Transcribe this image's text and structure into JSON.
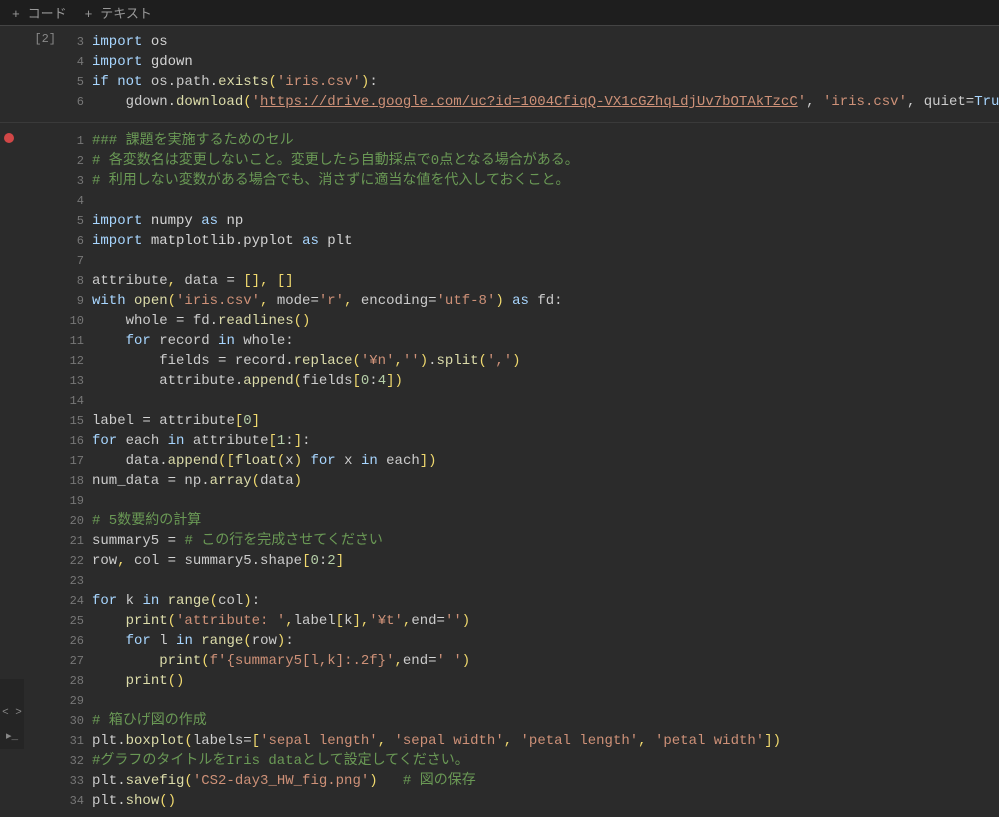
{
  "toolbar": {
    "code_btn": "+ コード",
    "text_btn": "+ テキスト"
  },
  "cell1": {
    "prompt": "[2]",
    "lines": [
      {
        "n": "3",
        "html": "<span class='kw'>import</span> <span class='mod'>os</span>"
      },
      {
        "n": "4",
        "html": "<span class='kw'>import</span> <span class='mod'>gdown</span>"
      },
      {
        "n": "5",
        "html": "<span class='kw'>if</span> <span class='kw'>not</span> os.path.<span class='builtin'>exists</span><span class='pun'>(</span><span class='str'>'iris.csv'</span><span class='pun'>)</span>:"
      },
      {
        "n": "6",
        "html": "    gdown.<span class='builtin'>download</span><span class='pun'>(</span><span class='str'>'<span class='url'>https://drive.google.com/uc?id=1004CfiqQ-VX1cGZhqLdjUv7bOTAkTzcC</span>'</span>, <span class='str'>'iris.csv'</span>, quiet=<span class='kw'>True</span><span class='pun'>)</span>"
      }
    ]
  },
  "cell2": {
    "lines": [
      {
        "n": "1",
        "html": "<span class='cmt'>### 課題を実施するためのセル</span>"
      },
      {
        "n": "2",
        "html": "<span class='cmt'># 各変数名は変更しないこと。変更したら自動採点で0点となる場合がある。</span>"
      },
      {
        "n": "3",
        "html": "<span class='cmt'># 利用しない変数がある場合でも、消さずに適当な値を代入しておくこと。</span>"
      },
      {
        "n": "4",
        "html": ""
      },
      {
        "n": "5",
        "html": "<span class='kw'>import</span> <span class='mod'>numpy</span> <span class='kw'>as</span> <span class='mod'>np</span>"
      },
      {
        "n": "6",
        "html": "<span class='kw'>import</span> <span class='mod'>matplotlib.pyplot</span> <span class='kw'>as</span> <span class='mod'>plt</span>"
      },
      {
        "n": "7",
        "html": ""
      },
      {
        "n": "8",
        "html": "attribute<span class='pun'>,</span> data <span class='op'>=</span> <span class='pun'>[]</span><span class='pun'>,</span> <span class='pun'>[]</span>"
      },
      {
        "n": "9",
        "html": "<span class='kw'>with</span> <span class='builtin'>open</span><span class='pun'>(</span><span class='str'>'iris.csv'</span><span class='pun'>,</span> mode<span class='op'>=</span><span class='str'>'r'</span><span class='pun'>,</span> encoding<span class='op'>=</span><span class='str'>'utf-8'</span><span class='pun'>)</span> <span class='kw'>as</span> fd:"
      },
      {
        "n": "10",
        "html": "    whole <span class='op'>=</span> fd.<span class='builtin'>readlines</span><span class='pun'>()</span>"
      },
      {
        "n": "11",
        "html": "    <span class='kw'>for</span> record <span class='kw'>in</span> whole:"
      },
      {
        "n": "12",
        "html": "        fields <span class='op'>=</span> record.<span class='builtin'>replace</span><span class='pun'>(</span><span class='str'>'¥n'</span><span class='pun'>,</span><span class='str'>''</span><span class='pun'>)</span>.<span class='builtin'>split</span><span class='pun'>(</span><span class='str'>','</span><span class='pun'>)</span>"
      },
      {
        "n": "13",
        "html": "        attribute.<span class='builtin'>append</span><span class='pun'>(</span>fields<span class='pun'>[</span><span class='num'>0</span>:<span class='num'>4</span><span class='pun'>])</span>"
      },
      {
        "n": "14",
        "html": ""
      },
      {
        "n": "15",
        "html": "label <span class='op'>=</span> attribute<span class='pun'>[</span><span class='num'>0</span><span class='pun'>]</span>"
      },
      {
        "n": "16",
        "html": "<span class='kw'>for</span> each <span class='kw'>in</span> attribute<span class='pun'>[</span><span class='num'>1</span>:<span class='pun'>]</span>:"
      },
      {
        "n": "17",
        "html": "    data.<span class='builtin'>append</span><span class='pun'>([</span><span class='builtin'>float</span><span class='pun'>(</span>x<span class='pun'>)</span> <span class='kw'>for</span> x <span class='kw'>in</span> each<span class='pun'>])</span>"
      },
      {
        "n": "18",
        "html": "num_data <span class='op'>=</span> np.<span class='builtin'>array</span><span class='pun'>(</span>data<span class='pun'>)</span>"
      },
      {
        "n": "19",
        "html": ""
      },
      {
        "n": "20",
        "html": "<span class='cmt'># 5数要約の計算</span>"
      },
      {
        "n": "21",
        "html": "summary5 <span class='op'>=</span> <span class='cmt'># この行を完成させてください</span>"
      },
      {
        "n": "22",
        "html": "row<span class='pun'>,</span> col <span class='op'>=</span> summary5.shape<span class='pun'>[</span><span class='num'>0</span>:<span class='num'>2</span><span class='pun'>]</span>"
      },
      {
        "n": "23",
        "html": ""
      },
      {
        "n": "24",
        "html": "<span class='kw'>for</span> k <span class='kw'>in</span> <span class='builtin'>range</span><span class='pun'>(</span>col<span class='pun'>)</span>:"
      },
      {
        "n": "25",
        "html": "    <span class='builtin'>print</span><span class='pun'>(</span><span class='str'>'attribute: '</span><span class='pun'>,</span>label<span class='pun'>[</span>k<span class='pun'>]</span><span class='pun'>,</span><span class='str'>'¥t'</span><span class='pun'>,</span>end<span class='op'>=</span><span class='str'>''</span><span class='pun'>)</span>"
      },
      {
        "n": "26",
        "html": "    <span class='kw'>for</span> l <span class='kw'>in</span> <span class='builtin'>range</span><span class='pun'>(</span>row<span class='pun'>)</span>:"
      },
      {
        "n": "27",
        "html": "        <span class='builtin'>print</span><span class='pun'>(</span><span class='str'>f'{summary5[l,k]:.2f}'</span><span class='pun'>,</span>end<span class='op'>=</span><span class='str'>' '</span><span class='pun'>)</span>"
      },
      {
        "n": "28",
        "html": "    <span class='builtin'>print</span><span class='pun'>()</span>"
      },
      {
        "n": "29",
        "html": ""
      },
      {
        "n": "30",
        "html": "<span class='cmt'># 箱ひげ図の作成</span>"
      },
      {
        "n": "31",
        "html": "plt.<span class='builtin'>boxplot</span><span class='pun'>(</span>labels<span class='op'>=</span><span class='pun'>[</span><span class='str'>'sepal length'</span><span class='pun'>,</span> <span class='str'>'sepal width'</span><span class='pun'>,</span> <span class='str'>'petal length'</span><span class='pun'>,</span> <span class='str'>'petal width'</span><span class='pun'>])</span>"
      },
      {
        "n": "32",
        "html": "<span class='cmt'>#グラフのタイトルをIris dataとして設定してください。</span>"
      },
      {
        "n": "33",
        "html": "plt.<span class='builtin'>savefig</span><span class='pun'>(</span><span class='str'>'CS2-day3_HW_fig.png'</span><span class='pun'>)</span>   <span class='cmt'># 図の保存</span>"
      },
      {
        "n": "34",
        "html": "plt.<span class='builtin'>show</span><span class='pun'>()</span>"
      }
    ]
  },
  "leftbar": {
    "item1": "< >",
    "item2": "▸_"
  }
}
